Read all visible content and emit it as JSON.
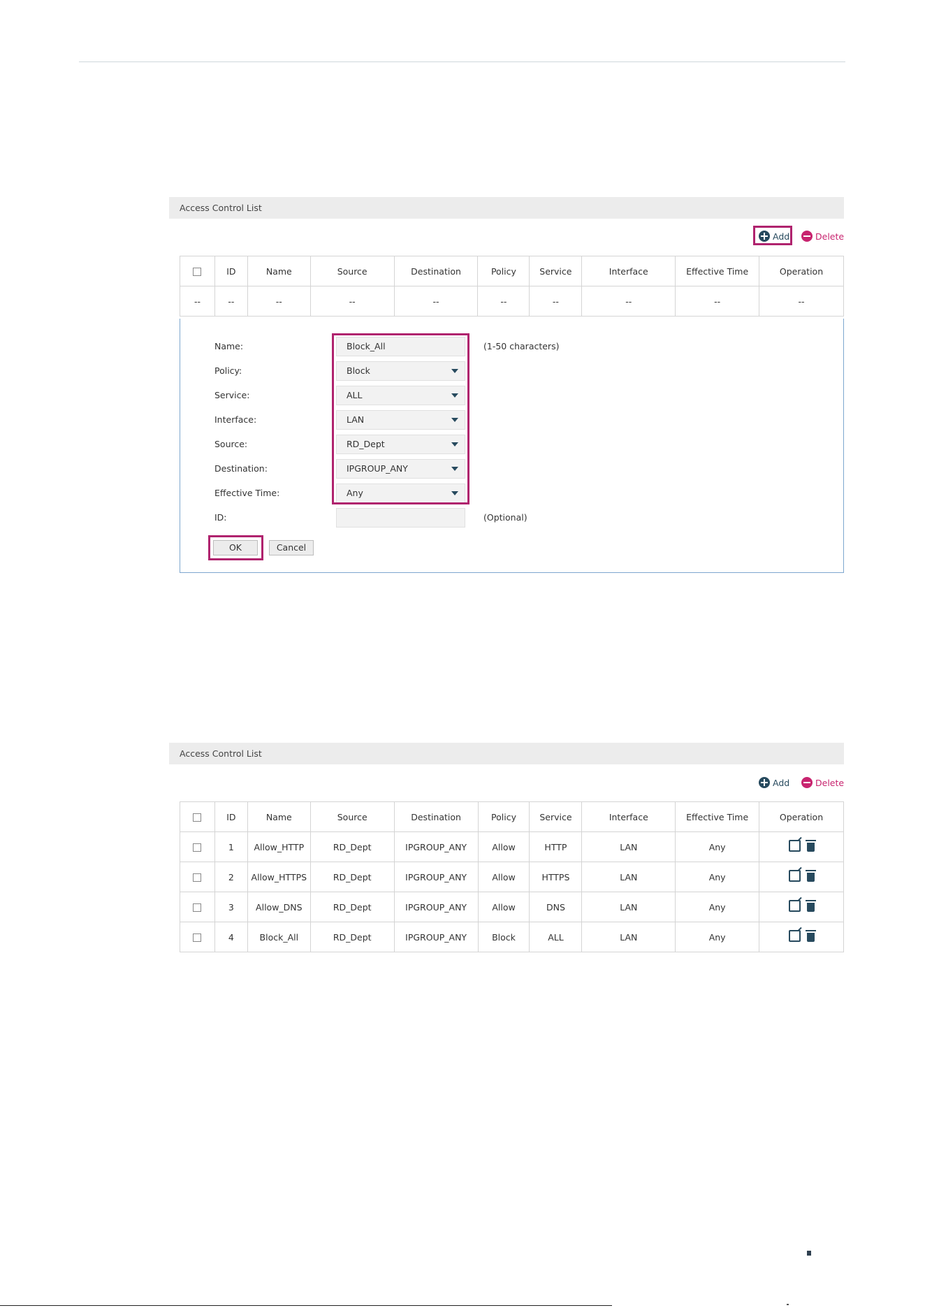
{
  "top_panel": {
    "title": "Access Control List",
    "add_label": "Add",
    "delete_label": "Delete",
    "headers": [
      "ID",
      "Name",
      "Source",
      "Destination",
      "Policy",
      "Service",
      "Interface",
      "Effective Time",
      "Operation"
    ],
    "empty_row": [
      "--",
      "--",
      "--",
      "--",
      "--",
      "--",
      "--",
      "--",
      "--",
      "--"
    ],
    "form": {
      "name_label": "Name:",
      "name_value": "Block_All",
      "name_hint": "(1-50 characters)",
      "policy_label": "Policy:",
      "policy_value": "Block",
      "service_label": "Service:",
      "service_value": "ALL",
      "interface_label": "Interface:",
      "interface_value": "LAN",
      "source_label": "Source:",
      "source_value": "RD_Dept",
      "destination_label": "Destination:",
      "destination_value": "IPGROUP_ANY",
      "effective_time_label": "Effective Time:",
      "effective_time_value": "Any",
      "id_label": "ID:",
      "id_value": "",
      "id_hint": "(Optional)",
      "ok_label": "OK",
      "cancel_label": "Cancel"
    }
  },
  "bottom_panel": {
    "title": "Access Control List",
    "add_label": "Add",
    "delete_label": "Delete",
    "headers": [
      "ID",
      "Name",
      "Source",
      "Destination",
      "Policy",
      "Service",
      "Interface",
      "Effective Time",
      "Operation"
    ],
    "rows": [
      {
        "id": "1",
        "name": "Allow_HTTP",
        "source": "RD_Dept",
        "destination": "IPGROUP_ANY",
        "policy": "Allow",
        "service": "HTTP",
        "interface": "LAN",
        "effective_time": "Any"
      },
      {
        "id": "2",
        "name": "Allow_HTTPS",
        "source": "RD_Dept",
        "destination": "IPGROUP_ANY",
        "policy": "Allow",
        "service": "HTTPS",
        "interface": "LAN",
        "effective_time": "Any"
      },
      {
        "id": "3",
        "name": "Allow_DNS",
        "source": "RD_Dept",
        "destination": "IPGROUP_ANY",
        "policy": "Allow",
        "service": "DNS",
        "interface": "LAN",
        "effective_time": "Any"
      },
      {
        "id": "4",
        "name": "Block_All",
        "source": "RD_Dept",
        "destination": "IPGROUP_ANY",
        "policy": "Block",
        "service": "ALL",
        "interface": "LAN",
        "effective_time": "Any"
      }
    ]
  },
  "colors": {
    "accent": "#274a5e",
    "highlight": "#b0236e",
    "delete": "#c8246f"
  }
}
